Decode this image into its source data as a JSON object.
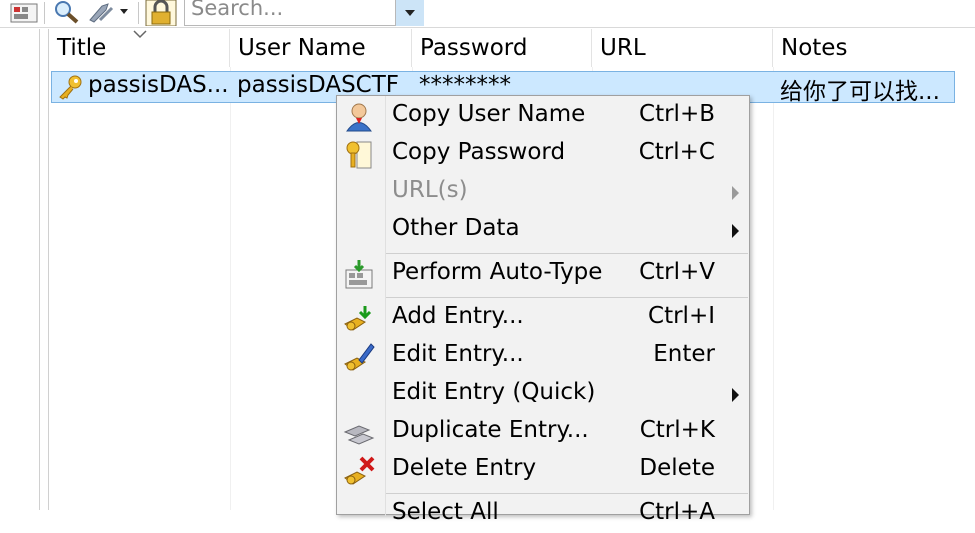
{
  "toolbar": {
    "icons": [
      "auto-type-icon",
      "find-icon",
      "tools-icon",
      "lock-icon"
    ],
    "search_placeholder": "Search..."
  },
  "list": {
    "columns": [
      "Title",
      "User Name",
      "Password",
      "URL",
      "Notes"
    ],
    "rows": [
      {
        "title": "passisDAS...",
        "user": "passisDASCTF",
        "password": "********",
        "url": "",
        "notes": "给你了可以找..."
      }
    ]
  },
  "context_menu": {
    "items": [
      {
        "label": "Copy User Name",
        "shortcut": "Ctrl+B",
        "icon": "user-icon"
      },
      {
        "label": "Copy Password",
        "shortcut": "Ctrl+C",
        "icon": "key-icon"
      },
      {
        "label": "URL(s)",
        "shortcut": "",
        "icon": "",
        "submenu": true,
        "disabled": true
      },
      {
        "label": "Other Data",
        "shortcut": "",
        "icon": "",
        "submenu": true
      },
      {
        "label": "Perform Auto-Type",
        "shortcut": "Ctrl+V",
        "icon": "auto-type-icon"
      },
      {
        "label": "Add Entry...",
        "shortcut": "Ctrl+I",
        "icon": "add-key-icon"
      },
      {
        "label": "Edit Entry...",
        "shortcut": "Enter",
        "icon": "edit-key-icon"
      },
      {
        "label": "Edit Entry (Quick)",
        "shortcut": "",
        "icon": "",
        "submenu": true
      },
      {
        "label": "Duplicate Entry...",
        "shortcut": "Ctrl+K",
        "icon": "duplicate-key-icon"
      },
      {
        "label": "Delete Entry",
        "shortcut": "Delete",
        "icon": "delete-key-icon"
      },
      {
        "label": "Select All",
        "shortcut": "Ctrl+A",
        "icon": ""
      }
    ]
  }
}
